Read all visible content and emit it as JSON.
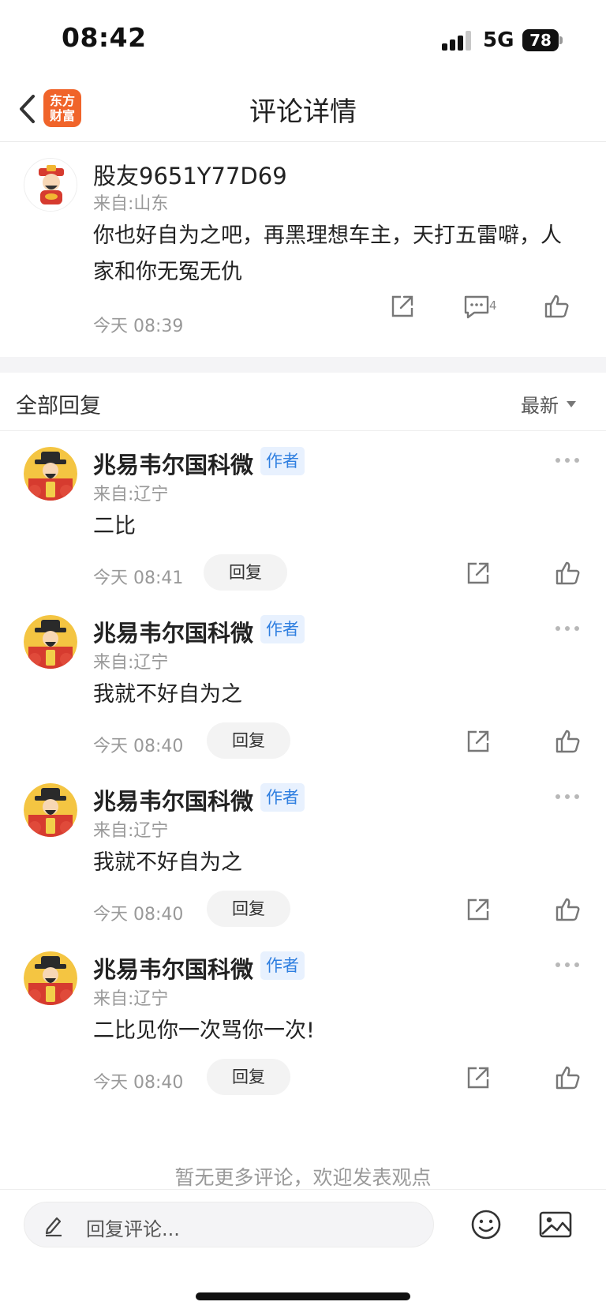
{
  "status_bar": {
    "time": "08:42",
    "network": "5G",
    "battery": "78"
  },
  "nav": {
    "title": "评论详情",
    "logo_text": [
      "东方",
      "财富"
    ]
  },
  "main_comment": {
    "username": "股友9651Y77D69",
    "location": "来自:山东",
    "text": "你也好自为之吧，再黑理想车主，天打五雷噼，人家和你无冤无仇",
    "time": "今天 08:39",
    "reply_count": "4"
  },
  "replies_header": {
    "title": "全部回复",
    "sort_label": "最新"
  },
  "replies": [
    {
      "username": "兆易韦尔国科微",
      "badge": "作者",
      "location": "来自:辽宁",
      "text": "二比",
      "time": "今天 08:41",
      "reply_label": "回复"
    },
    {
      "username": "兆易韦尔国科微",
      "badge": "作者",
      "location": "来自:辽宁",
      "text": "我就不好自为之",
      "time": "今天 08:40",
      "reply_label": "回复"
    },
    {
      "username": "兆易韦尔国科微",
      "badge": "作者",
      "location": "来自:辽宁",
      "text": "我就不好自为之",
      "time": "今天 08:40",
      "reply_label": "回复"
    },
    {
      "username": "兆易韦尔国科微",
      "badge": "作者",
      "location": "来自:辽宁",
      "text": "二比见你一次骂你一次!",
      "time": "今天 08:40",
      "reply_label": "回复"
    }
  ],
  "footer_note": "暂无更多评论，欢迎发表观点",
  "bottom_bar": {
    "placeholder": "回复评论..."
  },
  "colors": {
    "accent": "#2f7fe0",
    "logo": "#f0642a",
    "muted": "#999999"
  }
}
